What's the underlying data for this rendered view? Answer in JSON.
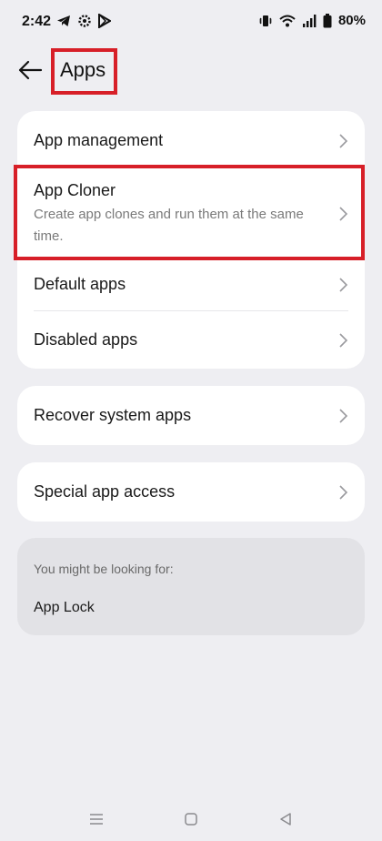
{
  "status_bar": {
    "time": "2:42",
    "left_icons": [
      "telegram-icon",
      "settings-gear-icon",
      "play-store-icon"
    ],
    "right_icons": [
      "vibrate-icon",
      "wifi-icon",
      "signal-icon",
      "battery-icon"
    ],
    "battery": "80%"
  },
  "header": {
    "back_icon": "arrow-left-icon",
    "title": "Apps"
  },
  "groups": [
    {
      "items": [
        {
          "title": "App management",
          "subtitle": ""
        },
        {
          "title": "App Cloner",
          "subtitle": "Create app clones and run them at the same time."
        },
        {
          "title": "Default apps",
          "subtitle": ""
        },
        {
          "title": "Disabled apps",
          "subtitle": ""
        }
      ]
    },
    {
      "items": [
        {
          "title": "Recover system apps"
        }
      ]
    },
    {
      "items": [
        {
          "title": "Special app access"
        }
      ]
    }
  ],
  "suggestions": {
    "label": "You might be looking for:",
    "items": [
      "App Lock"
    ]
  },
  "nav_bar": {
    "icons": [
      "menu-icon",
      "home-icon",
      "back-triangle-icon"
    ]
  },
  "colors": {
    "background": "#eeeef2",
    "card": "#ffffff",
    "highlight": "#d71f28"
  }
}
